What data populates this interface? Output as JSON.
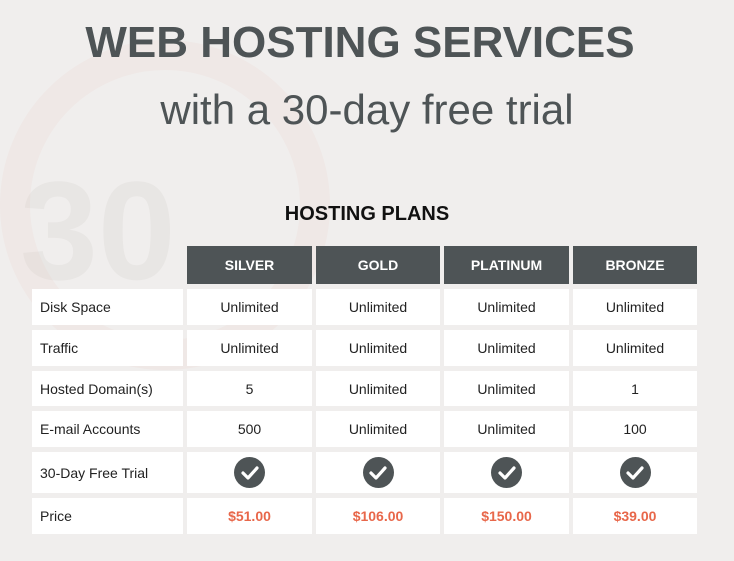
{
  "title": "WEB HOSTING SERVICES",
  "subtitle": "with a 30-day free trial",
  "table_title": "HOSTING PLANS",
  "plans": [
    "SILVER",
    "GOLD",
    "PLATINUM",
    "BRONZE"
  ],
  "rows": [
    {
      "label": "Disk Space",
      "values": [
        "Unlimited",
        "Unlimited",
        "Unlimited",
        "Unlimited"
      ]
    },
    {
      "label": "Traffic",
      "values": [
        "Unlimited",
        "Unlimited",
        "Unlimited",
        "Unlimited"
      ]
    },
    {
      "label": "Hosted Domain(s)",
      "values": [
        "5",
        "Unlimited",
        "Unlimited",
        "1"
      ]
    },
    {
      "label": "E-mail Accounts",
      "values": [
        "500",
        "Unlimited",
        "Unlimited",
        "100"
      ]
    },
    {
      "label": "30-Day Free Trial",
      "icon": "check-circle-icon",
      "values": [
        true,
        true,
        true,
        true
      ]
    },
    {
      "label": "Price",
      "values": [
        "$51.00",
        "$106.00",
        "$150.00",
        "$39.00"
      ]
    }
  ],
  "colors": {
    "header": "#4e5456",
    "price": "#e8674a",
    "background": "#f0eeed"
  }
}
